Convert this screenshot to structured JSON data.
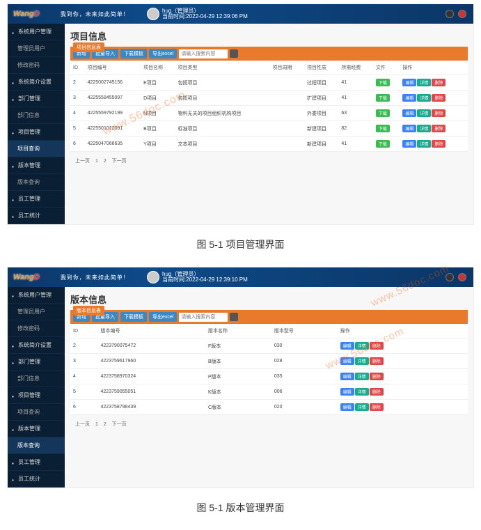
{
  "common": {
    "logo1": "Wang",
    "logo2": "D",
    "slogan": "我到你，未来如此简单！",
    "username": "hug（管理员）",
    "time_label": "当前时间:",
    "time1": "2022-04-29 12:39:06 PM",
    "time2": "2022-04-29 12:39:10 PM",
    "watermark": "www.56doc.com",
    "search_placeholder": "请输入搜索内容",
    "bar_buttons": [
      "新增",
      "批量导入",
      "下载模板",
      "导出excel"
    ],
    "pager_prev": "上一页",
    "pager_next": "下一页",
    "pager_1": "1",
    "pager_2": "2",
    "action_download": "下载",
    "action_edit": "编辑",
    "action_detail": "详情",
    "action_delete": "删除"
  },
  "sidebar": [
    {
      "label": "系统用户管理",
      "icon": "user"
    },
    {
      "label": "管理员用户",
      "indent": true
    },
    {
      "label": "修改密码",
      "indent": true
    },
    {
      "label": "系统简介设置",
      "icon": "gear"
    },
    {
      "label": "部门管理",
      "icon": "grid"
    },
    {
      "label": "部门信息",
      "indent": true
    },
    {
      "label": "项目管理",
      "icon": "folder"
    },
    {
      "label": "项目查询",
      "indent": true,
      "active": true,
      "scr": 1
    },
    {
      "label": "版本管理",
      "icon": "layers"
    },
    {
      "label": "版本查询",
      "indent": true,
      "active": true,
      "scr": 2
    },
    {
      "label": "员工管理",
      "icon": "users"
    },
    {
      "label": "员工统计",
      "icon": "chart"
    }
  ],
  "screen1": {
    "title": "项目信息",
    "tablabel": "项目信息表",
    "headers": [
      "ID",
      "项目编号",
      "项目名称",
      "项目类型",
      "项目周期",
      "项目性质",
      "所需经费",
      "文件",
      "操作"
    ],
    "rows": [
      [
        "2",
        "4225002745156",
        "E项目",
        "包揽项目",
        "",
        "过程项目",
        "41"
      ],
      [
        "3",
        "4225558455097",
        "D项目",
        "包揽项目",
        "",
        "扩建项目",
        "41"
      ],
      [
        "4",
        "4225559792199",
        "N项目",
        "物料无关的项目组织机构项目",
        "",
        "外委项目",
        "63"
      ],
      [
        "5",
        "4225501012091",
        "B项目",
        "标准项目",
        "",
        "新建项目",
        "82"
      ],
      [
        "6",
        "4225047066635",
        "Y项目",
        "文本项目",
        "",
        "新建项目",
        "41"
      ]
    ]
  },
  "screen2": {
    "title": "版本信息",
    "tablabel": "版本信息表",
    "headers": [
      "ID",
      "版本编号",
      "版本名称",
      "版本型号",
      "操作"
    ],
    "rows": [
      [
        "2",
        "4223790075472",
        "F版本",
        "030"
      ],
      [
        "3",
        "4223759617960",
        "B版本",
        "028"
      ],
      [
        "4",
        "4223758970324",
        "P版本",
        "035"
      ],
      [
        "5",
        "4223759055051",
        "K版本",
        "006"
      ],
      [
        "6",
        "4223758798439",
        "C版本",
        "020"
      ]
    ]
  },
  "captions": {
    "c1": "图 5-1 项目管理界面",
    "c2": "图 5-1 版本管理界面"
  }
}
